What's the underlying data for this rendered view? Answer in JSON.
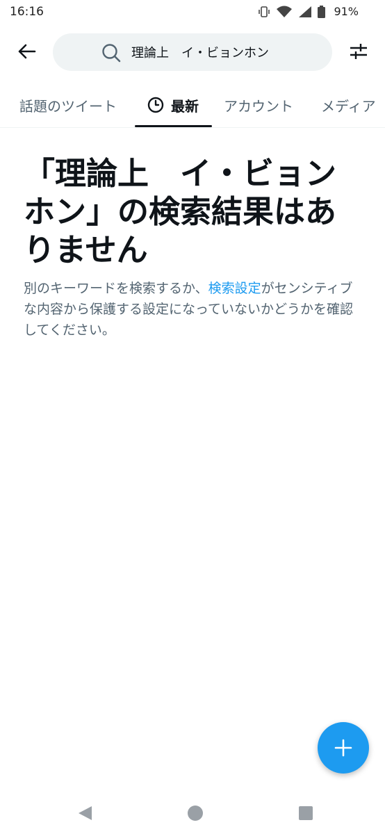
{
  "status_bar": {
    "time": "16:16",
    "battery": "91%",
    "icons": [
      "vibrate-icon",
      "wifi-icon",
      "signal-icon",
      "battery-icon"
    ]
  },
  "header": {
    "back_icon": "arrow-left-icon",
    "search_query": "理論上　イ・ビョンホン",
    "search_icon": "search-icon",
    "filter_icon": "sliders-icon"
  },
  "tabs": [
    {
      "label": "話題のツイート",
      "active": false
    },
    {
      "label": "最新",
      "active": true,
      "icon": "clock-icon"
    },
    {
      "label": "アカウント",
      "active": false
    },
    {
      "label": "メディア",
      "active": false
    }
  ],
  "empty_state": {
    "title": "「理論上　イ・ビョンホン」の検索結果はありません",
    "desc_before": "別のキーワードを検索するか、",
    "desc_link": "検索設定",
    "desc_after": "がセンシティブな内容から保護する設定になっていないかどうかを確認してください。"
  },
  "fab": {
    "icon": "plus-icon"
  },
  "nav_bar": {
    "icons": [
      "nav-back-icon",
      "nav-home-icon",
      "nav-recents-icon"
    ]
  },
  "colors": {
    "accent": "#1d9bf0",
    "text_primary": "#0f1419",
    "text_secondary": "#536471",
    "search_bg": "#eff3f4"
  }
}
